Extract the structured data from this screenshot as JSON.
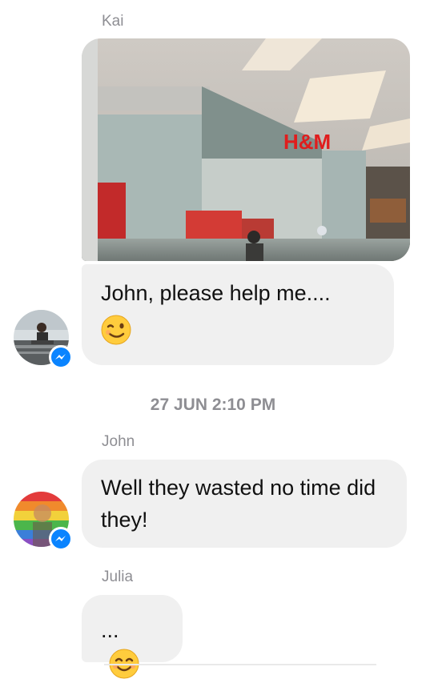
{
  "messages": [
    {
      "sender": "Kai",
      "photo_sign": "H&M",
      "text": "John, please help me....",
      "emoji": "wink-face"
    },
    {
      "timestamp": "27 JUN 2:10 PM"
    },
    {
      "sender": "John",
      "text": "Well they wasted no time did they!"
    },
    {
      "sender": "Julia",
      "text": "...",
      "emoji": "smiling-face"
    }
  ],
  "colors": {
    "bubble": "#f0f0f0",
    "sender_text": "#8e8e93",
    "messenger_badge": "#0a84ff"
  },
  "icons": {
    "badge": "messenger-icon"
  }
}
